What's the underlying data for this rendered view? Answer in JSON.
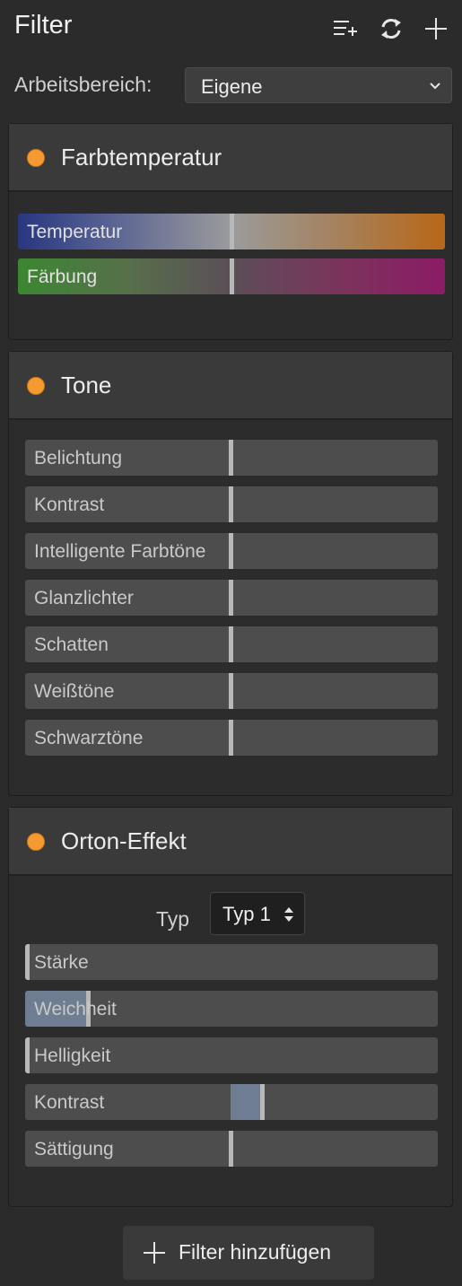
{
  "header": {
    "title": "Filter",
    "icons": [
      "filter-list-icon",
      "refresh-icon",
      "add-icon"
    ]
  },
  "workspace": {
    "label": "Arbeitsbereich:",
    "value": "Eigene"
  },
  "panels": {
    "temperature": {
      "title": "Farbtemperatur",
      "sliders": [
        {
          "label": "Temperatur",
          "value": 0
        },
        {
          "label": "Färbung",
          "value": 0
        }
      ]
    },
    "tone": {
      "title": "Tone",
      "sliders": [
        {
          "label": "Belichtung",
          "value": 0
        },
        {
          "label": "Kontrast",
          "value": 0
        },
        {
          "label": "Intelligente Farbtöne",
          "value": 0
        },
        {
          "label": "Glanzlichter",
          "value": 0
        },
        {
          "label": "Schatten",
          "value": 0
        },
        {
          "label": "Weißtöne",
          "value": 0
        },
        {
          "label": "Schwarztöne",
          "value": 0
        }
      ]
    },
    "orton": {
      "title": "Orton-Effekt",
      "type_label": "Typ",
      "type_value": "Typ 1",
      "sliders": [
        {
          "label": "Stärke",
          "value": 0
        },
        {
          "label": "Weichheit",
          "value": 0.15
        },
        {
          "label": "Helligkeit",
          "value": 0
        },
        {
          "label": "Kontrast",
          "value": 0.08
        },
        {
          "label": "Sättigung",
          "value": 0
        }
      ]
    }
  },
  "add_filter": {
    "label": "Filter hinzufügen"
  },
  "colors": {
    "accent_dot": "#f59a31",
    "slider_fill": "#6e7d92"
  }
}
